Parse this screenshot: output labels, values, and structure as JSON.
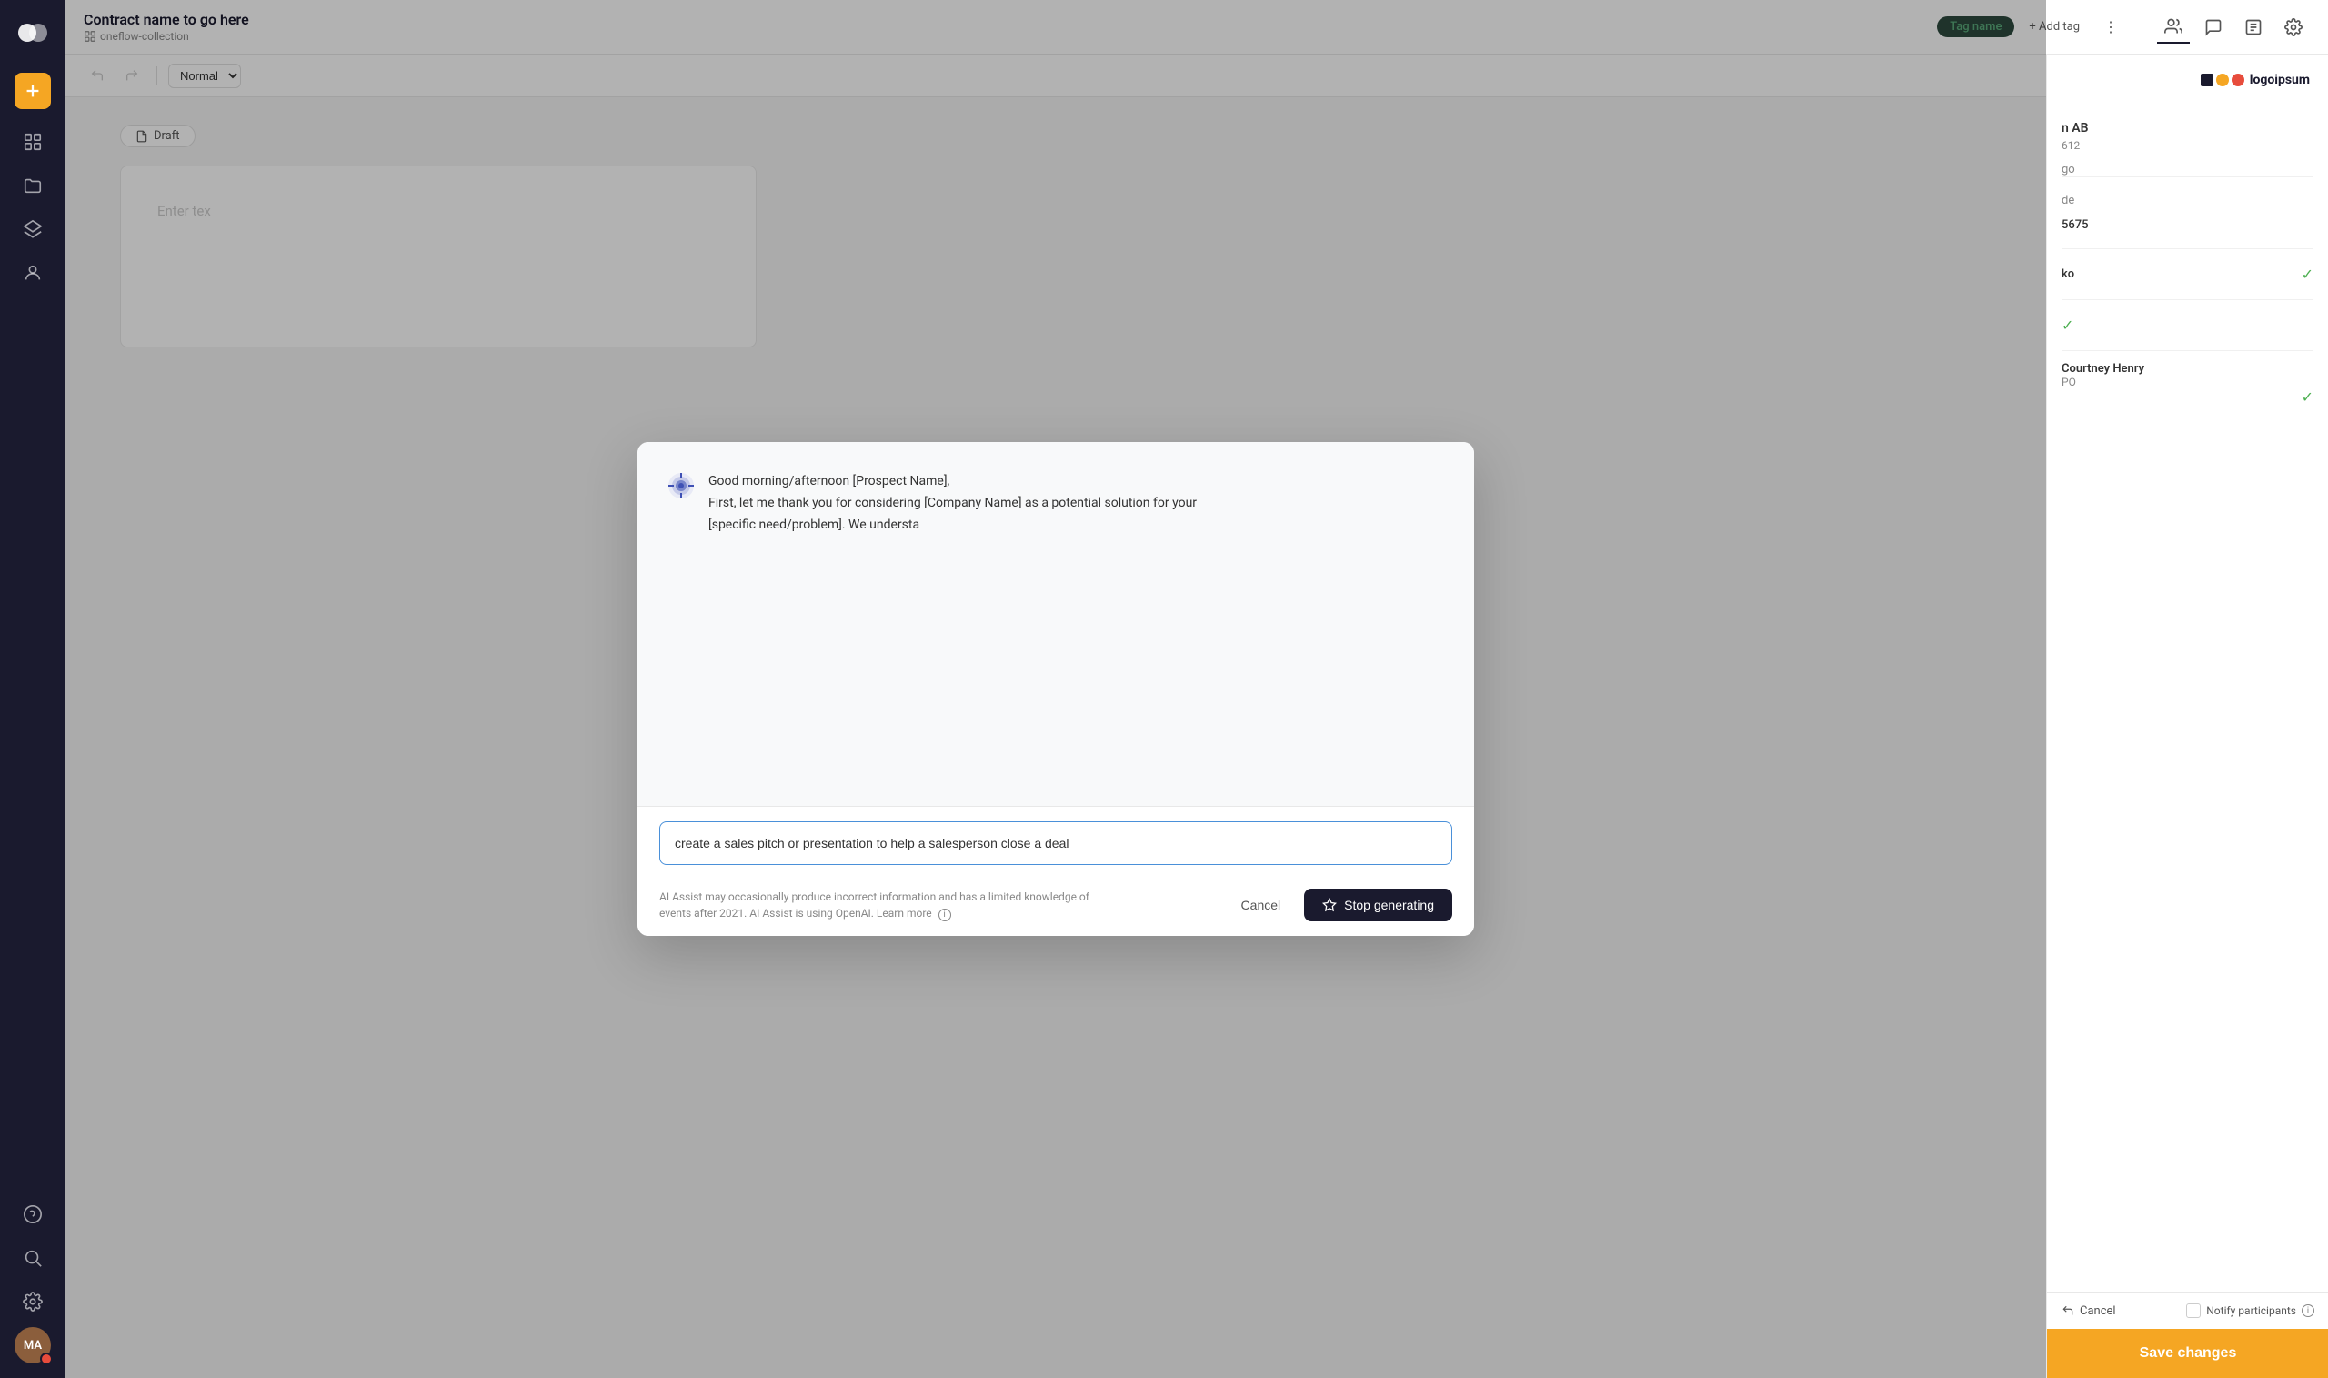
{
  "app": {
    "logo_text": "o",
    "contract_title": "Contract name to go here",
    "contract_collection": "oneflow-collection"
  },
  "topbar": {
    "tag_name": "Tag name",
    "add_tag": "+ Add tag",
    "more_icon": "⋮"
  },
  "toolbar": {
    "undo_label": "↩",
    "redo_label": "↪",
    "normal_text": "Normal"
  },
  "doc": {
    "status": "Draft",
    "placeholder": "Enter tex"
  },
  "modal": {
    "close_icon": "✕",
    "ai_message_line1": "Good morning/afternoon [Prospect Name],",
    "ai_message_line2": "First, let me thank you for considering [Company Name] as a potential solution for your",
    "ai_message_line3": "[specific need/problem]. We understa",
    "input_value": "create a sales pitch or presentation to help a salesperson close a deal ",
    "disclaimer": "AI Assist may occasionally produce incorrect information and has a limited knowledge of events after 2021. AI Assist is using OpenAI. Learn more",
    "cancel_label": "Cancel",
    "stop_label": "Stop generating"
  },
  "right_panel": {
    "logo_text": "logoipsum",
    "company_name": "n AB",
    "company_id": "612",
    "logo_placeholder": "go",
    "id_label": "de",
    "field1_value": "5675",
    "field2_value": "ko",
    "person_name": "Courtney Henry",
    "person_role": "PO",
    "cancel_label": "Cancel",
    "notify_label": "Notify participants",
    "save_label": "Save changes"
  },
  "sidebar": {
    "avatar_initials": "MA",
    "icons": [
      "grid",
      "folder",
      "layers",
      "person",
      "question",
      "search",
      "settings"
    ]
  }
}
